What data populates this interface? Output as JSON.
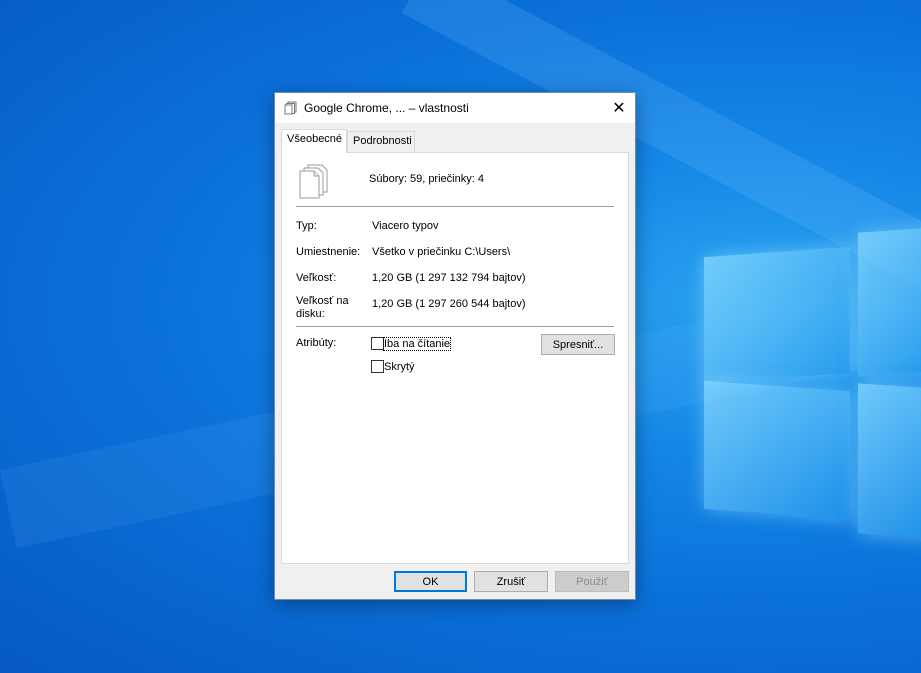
{
  "window": {
    "title": "Google Chrome, ... – vlastnosti",
    "close_symbol": "✕"
  },
  "tabs": [
    {
      "label": "Všeobecné",
      "active": true
    },
    {
      "label": "Podrobnosti",
      "active": false
    }
  ],
  "summary": {
    "icon": "multiple-files-icon",
    "text": "Súbory: 59, priečinky: 4"
  },
  "details": {
    "type_label": "Typ:",
    "type_value": "Viacero typov",
    "location_label": "Umiestnenie:",
    "location_value": "Všetko v priečinku C:\\Users\\",
    "size_label": "Veľkosť:",
    "size_value": "1,20 GB (1 297 132 794 bajtov)",
    "disk_size_label_line1": "Veľkosť na",
    "disk_size_label_line2": "disku:",
    "disk_size_value": "1,20 GB (1 297 260 544 bajtov)"
  },
  "attributes": {
    "label": "Atribúty:",
    "readonly_label": "Iba na čítanie",
    "readonly_checked": false,
    "hidden_label": "Skrytý",
    "hidden_checked": false,
    "advanced_button": "Spresniť..."
  },
  "buttons": {
    "ok": "OK",
    "cancel": "Zrušiť",
    "apply": "Použiť"
  },
  "colors": {
    "desktop_blue": "#0a6fd8",
    "accent": "#0078d7"
  }
}
